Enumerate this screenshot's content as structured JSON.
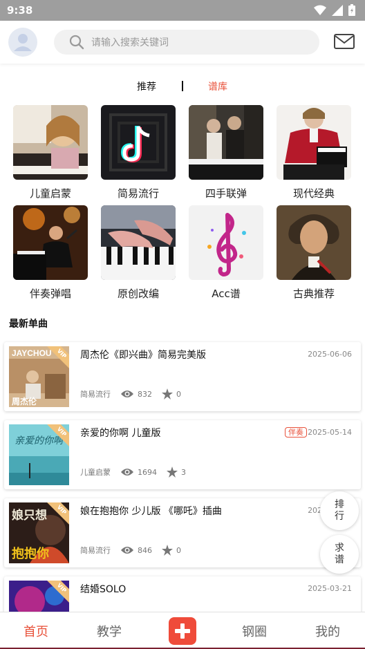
{
  "status_bar": {
    "time": "9:38"
  },
  "header": {
    "search_placeholder": "请输入搜索关键词"
  },
  "tabs": [
    {
      "label": "推荐",
      "active": false
    },
    {
      "label": "谱库",
      "active": true
    }
  ],
  "categories": [
    {
      "label": "儿童启蒙",
      "icon": "child-piano-photo"
    },
    {
      "label": "简易流行",
      "icon": "tiktok-photo"
    },
    {
      "label": "四手联弹",
      "icon": "duet-photo"
    },
    {
      "label": "现代经典",
      "icon": "pianist-photo"
    },
    {
      "label": "伴奏弹唱",
      "icon": "singer-piano-photo"
    },
    {
      "label": "原创改编",
      "icon": "hands-on-keys-photo"
    },
    {
      "label": "Acc谱",
      "icon": "treble-clef-icon"
    },
    {
      "label": "古典推荐",
      "icon": "beethoven-photo"
    }
  ],
  "section_title": "最新单曲",
  "songs": [
    {
      "title": "周杰伦《即兴曲》简易完美版",
      "date": "2025-06-06",
      "tag": "",
      "category": "简易流行",
      "views": "832",
      "stars": "0",
      "vip": "VIP",
      "cover_text": "JAYCHOU",
      "cover_subtext": "周杰伦"
    },
    {
      "title": "亲爱的你啊 儿童版",
      "date": "2025-05-14",
      "tag": "伴奏",
      "category": "儿童启蒙",
      "views": "1694",
      "stars": "3",
      "vip": "VIP",
      "cover_text": "亲爱的你啊"
    },
    {
      "title": "娘在抱抱你 少儿版 《哪吒》插曲",
      "date": "2025-05-16",
      "tag": "",
      "category": "简易流行",
      "views": "846",
      "stars": "0",
      "vip": "VIP",
      "cover_text": "娘只想",
      "cover_subtext": "抱抱你"
    },
    {
      "title": "结婚SOLO",
      "date": "2025-03-21",
      "tag": "",
      "category": "",
      "views": "",
      "stars": "",
      "vip": "VIP"
    }
  ],
  "fabs": {
    "rank": "排行",
    "request": "求谱"
  },
  "bottom_nav": [
    {
      "label": "首页",
      "active": true
    },
    {
      "label": "教学",
      "active": false
    },
    {
      "label": "钢圈",
      "active": false
    },
    {
      "label": "我的",
      "active": false
    }
  ],
  "colors": {
    "accent": "#e8513a",
    "add_button": "#ef4b3a",
    "vip_badge": "#f1c17a"
  }
}
